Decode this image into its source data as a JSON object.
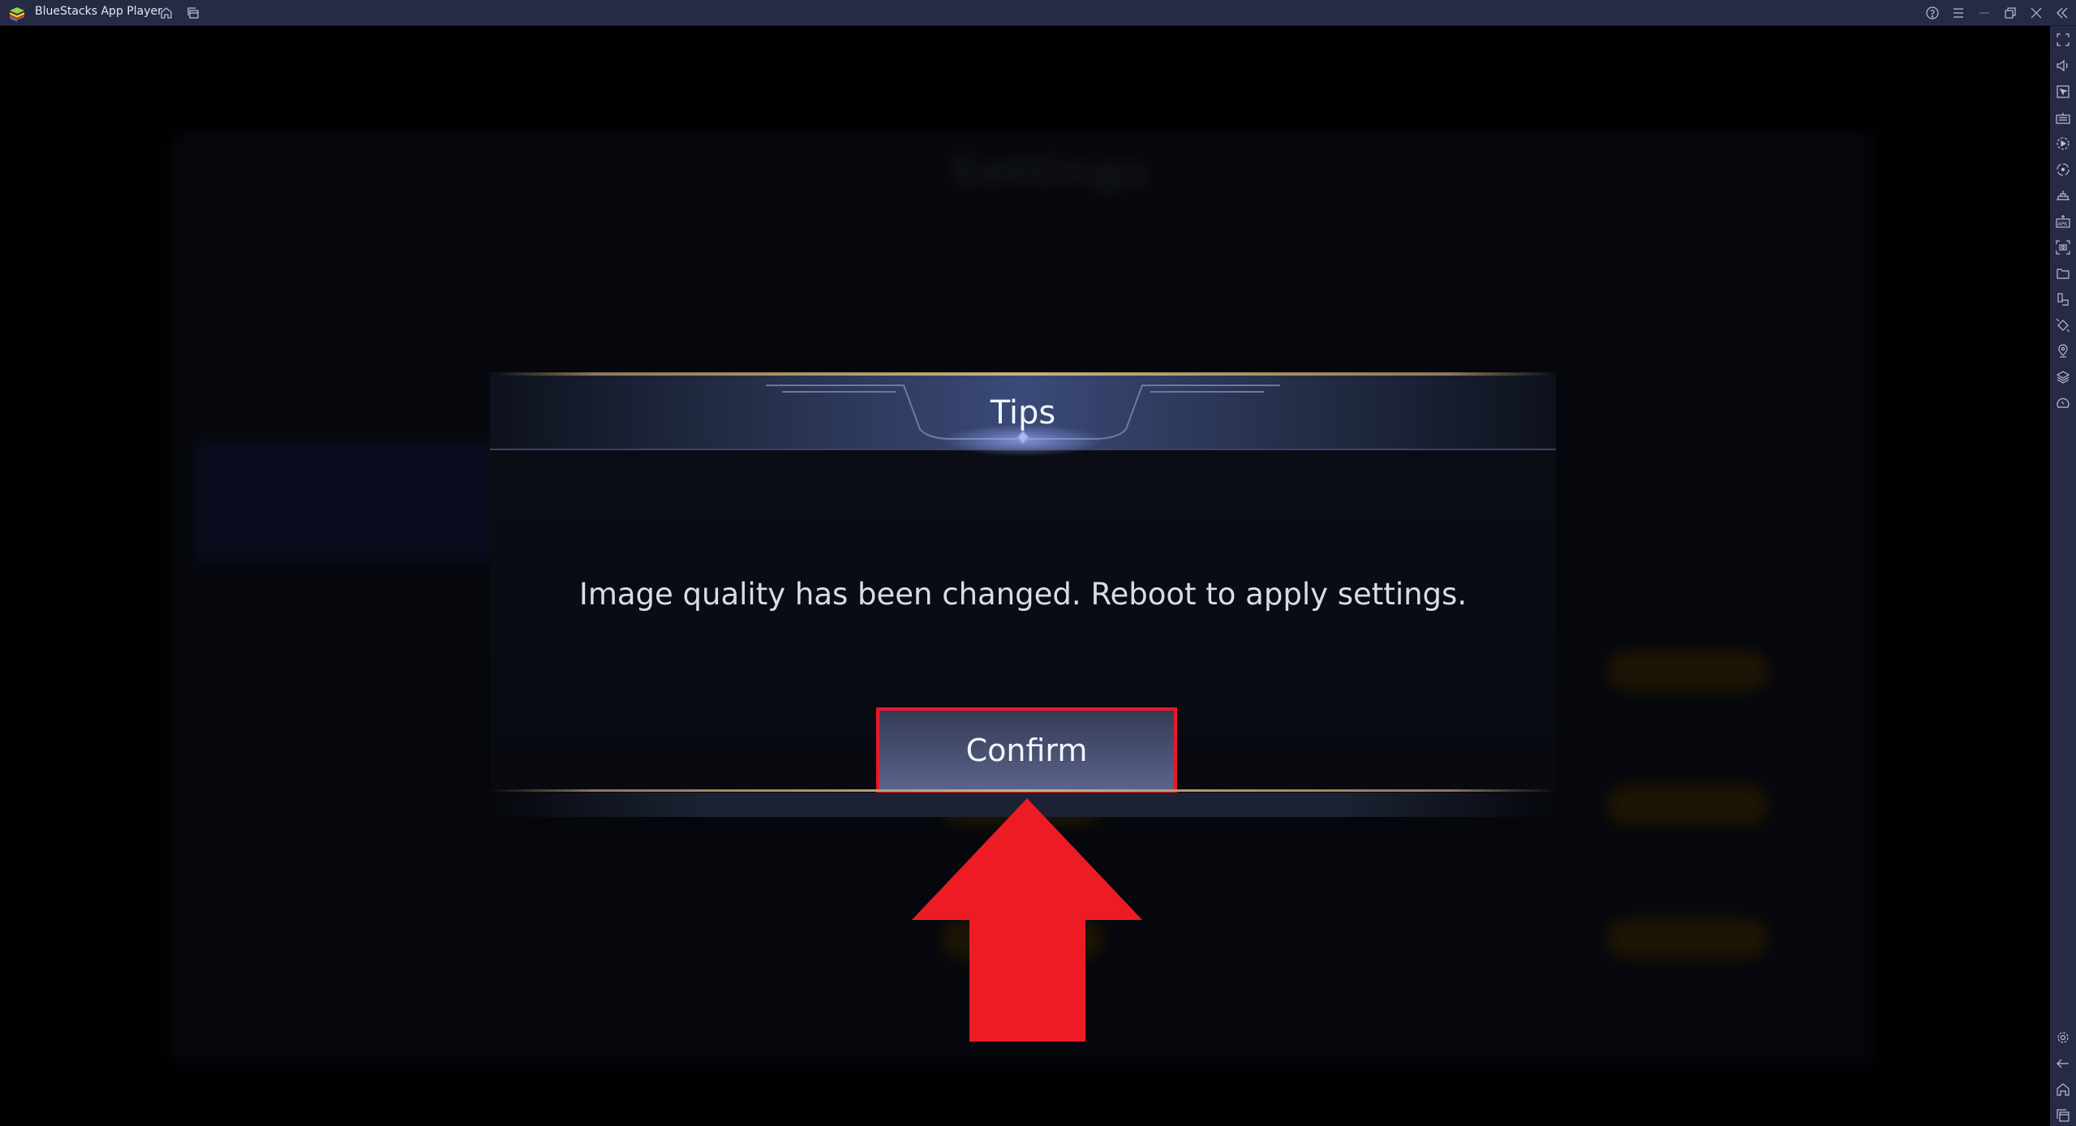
{
  "window": {
    "title": "BlueStacks App Player"
  },
  "titlebar": {
    "left_icons": [
      "home-icon",
      "multi-instance-icon"
    ],
    "right_icons": [
      "help-icon",
      "menu-icon",
      "minimize-icon",
      "restore-icon",
      "close-icon",
      "collapse-sidebar-icon"
    ]
  },
  "sidebar": {
    "top_icons": [
      "fullscreen-icon",
      "volume-icon",
      "pointer-icon",
      "keyboard-icon",
      "macro-play-icon",
      "record-icon",
      "game-controls-icon",
      "install-apk-icon",
      "screenshot-icon",
      "folder-icon",
      "multi-instance-sync-icon",
      "rotate-icon",
      "location-icon",
      "layers-icon",
      "performance-icon"
    ],
    "bottom_icons": [
      "settings-icon",
      "back-icon",
      "home-icon",
      "recent-apps-icon"
    ]
  },
  "background": {
    "title": "Settings"
  },
  "dialog": {
    "title": "Tips",
    "message": "Image quality has been changed. Reboot to apply settings.",
    "confirm_label": "Confirm"
  },
  "colors": {
    "titlebar": "#262a45",
    "highlight": "#e8192c",
    "accent_gold": "#c9b27a"
  }
}
